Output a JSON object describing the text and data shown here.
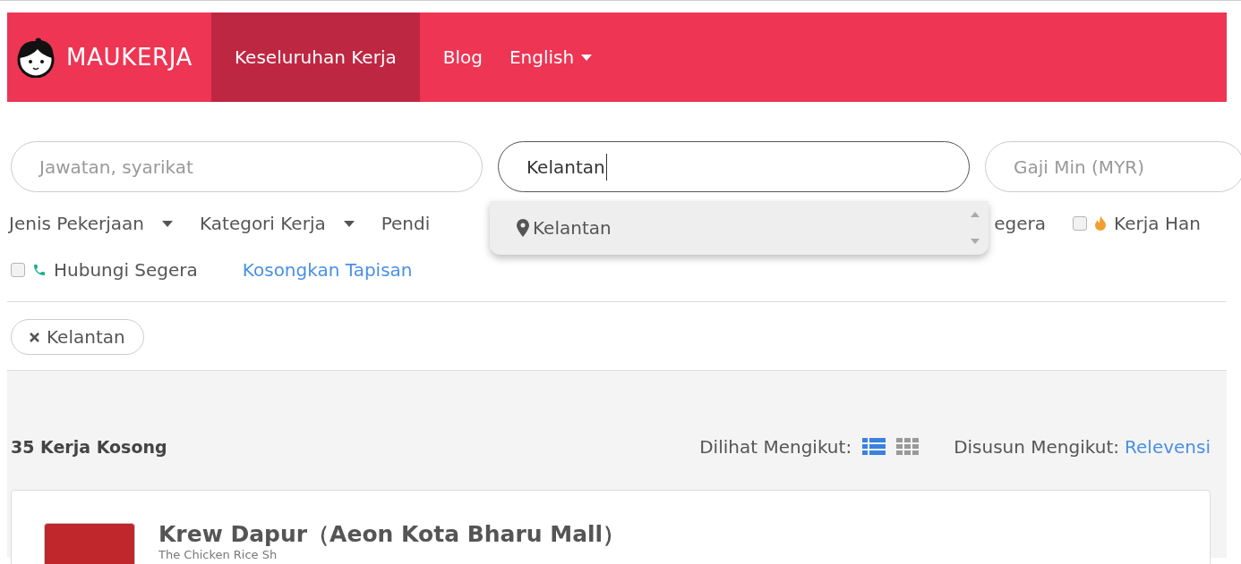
{
  "header": {
    "logo": "MAUKERJA",
    "nav": [
      {
        "label": "Keseluruhan Kerja",
        "selected": true
      },
      {
        "label": "Blog",
        "selected": false
      }
    ],
    "language": "English"
  },
  "search": {
    "fields": [
      {
        "placeholder": "Jawatan, syarikat"
      },
      {
        "value": "Kelantan"
      },
      {
        "placeholder": "Gaji Min (MYR)"
      }
    ],
    "suggestions": [
      {
        "label": "Kelantan"
      }
    ]
  },
  "filters": {
    "dropdowns": [
      {
        "label": "Jenis Pekerjaan"
      },
      {
        "label": "Kategori Kerja"
      }
    ],
    "hidden_start": "Pendi",
    "hidden_end": "egera",
    "checkboxes": [
      {
        "label": "Kerja Han",
        "kind": "fire",
        "checked": false
      },
      {
        "label": "Hubungi Segera",
        "kind": "phone",
        "checked": false
      }
    ],
    "clear": "Kosongkan Tapisan"
  },
  "chips": [
    {
      "label": "Kelantan"
    }
  ],
  "results": {
    "count": "35 Kerja Kosong",
    "view_label": "Dilihat Mengikut:",
    "views": [
      {
        "kind": "list",
        "selected": true
      },
      {
        "kind": "grid",
        "selected": false
      }
    ],
    "sort_label": "Disusun Mengikut:",
    "sort_value": "Relevensi"
  },
  "jobs": [
    {
      "title": "Krew Dapur（Aeon Kota Bharu Mall）",
      "company": "The Chicken Rice Sh"
    }
  ]
}
